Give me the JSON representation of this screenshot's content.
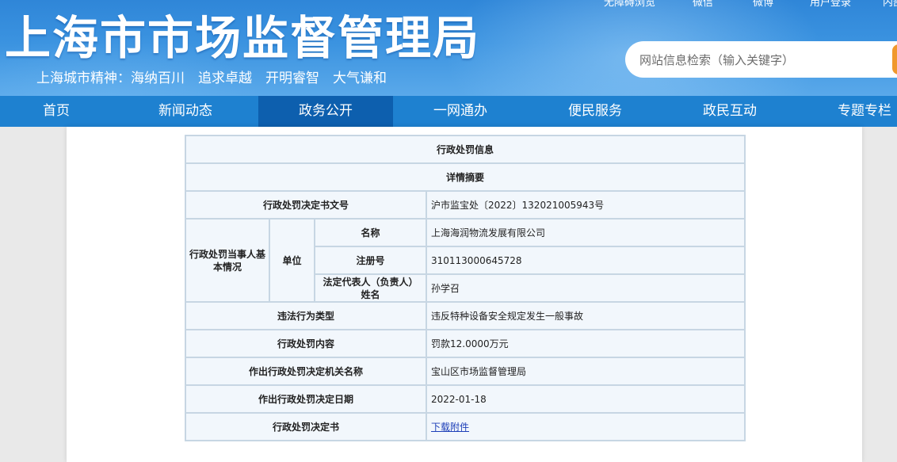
{
  "header": {
    "top_links": [
      "无障碍浏览",
      "微信",
      "微博",
      "用户登录",
      "内部"
    ],
    "title": "上海市市场监督管理局",
    "slogan": "上海城市精神：海纳百川　追求卓越　开明睿智　大气谦和",
    "search_placeholder": "网站信息检索（输入关键字）"
  },
  "nav": {
    "items": [
      "首页",
      "新闻动态",
      "政务公开",
      "一网通办",
      "便民服务",
      "政民互动",
      "专题专栏"
    ],
    "active_index": 2
  },
  "table": {
    "title": "行政处罚信息",
    "summary": "详情摘要",
    "doc_no_label": "行政处罚决定书文号",
    "doc_no_value": "沪市监宝处〔2022〕132021005943号",
    "party_label": "行政处罚当事人基本情况",
    "party_type": "单位",
    "name_label": "名称",
    "name_value": "上海海润物流发展有限公司",
    "reg_label": "注册号",
    "reg_value": "310113000645728",
    "rep_label": "法定代表人（负责人）姓名",
    "rep_value": "孙学召",
    "violation_label": "违法行为类型",
    "violation_value": "违反特种设备安全规定发生一般事故",
    "penalty_label": "行政处罚内容",
    "penalty_value": "罚款12.0000万元",
    "org_label": "作出行政处罚决定机关名称",
    "org_value": "宝山区市场监督管理局",
    "date_label": "作出行政处罚决定日期",
    "date_value": "2022-01-18",
    "doc_label": "行政处罚决定书",
    "doc_link": "下载附件"
  },
  "colors": {
    "nav_bg": "#1e81d0",
    "nav_active": "#0d5fae",
    "table_bg": "#f2f7fc",
    "table_border": "#c7d6e3",
    "search_button": "#f0982d",
    "link": "#1d3fb8"
  }
}
